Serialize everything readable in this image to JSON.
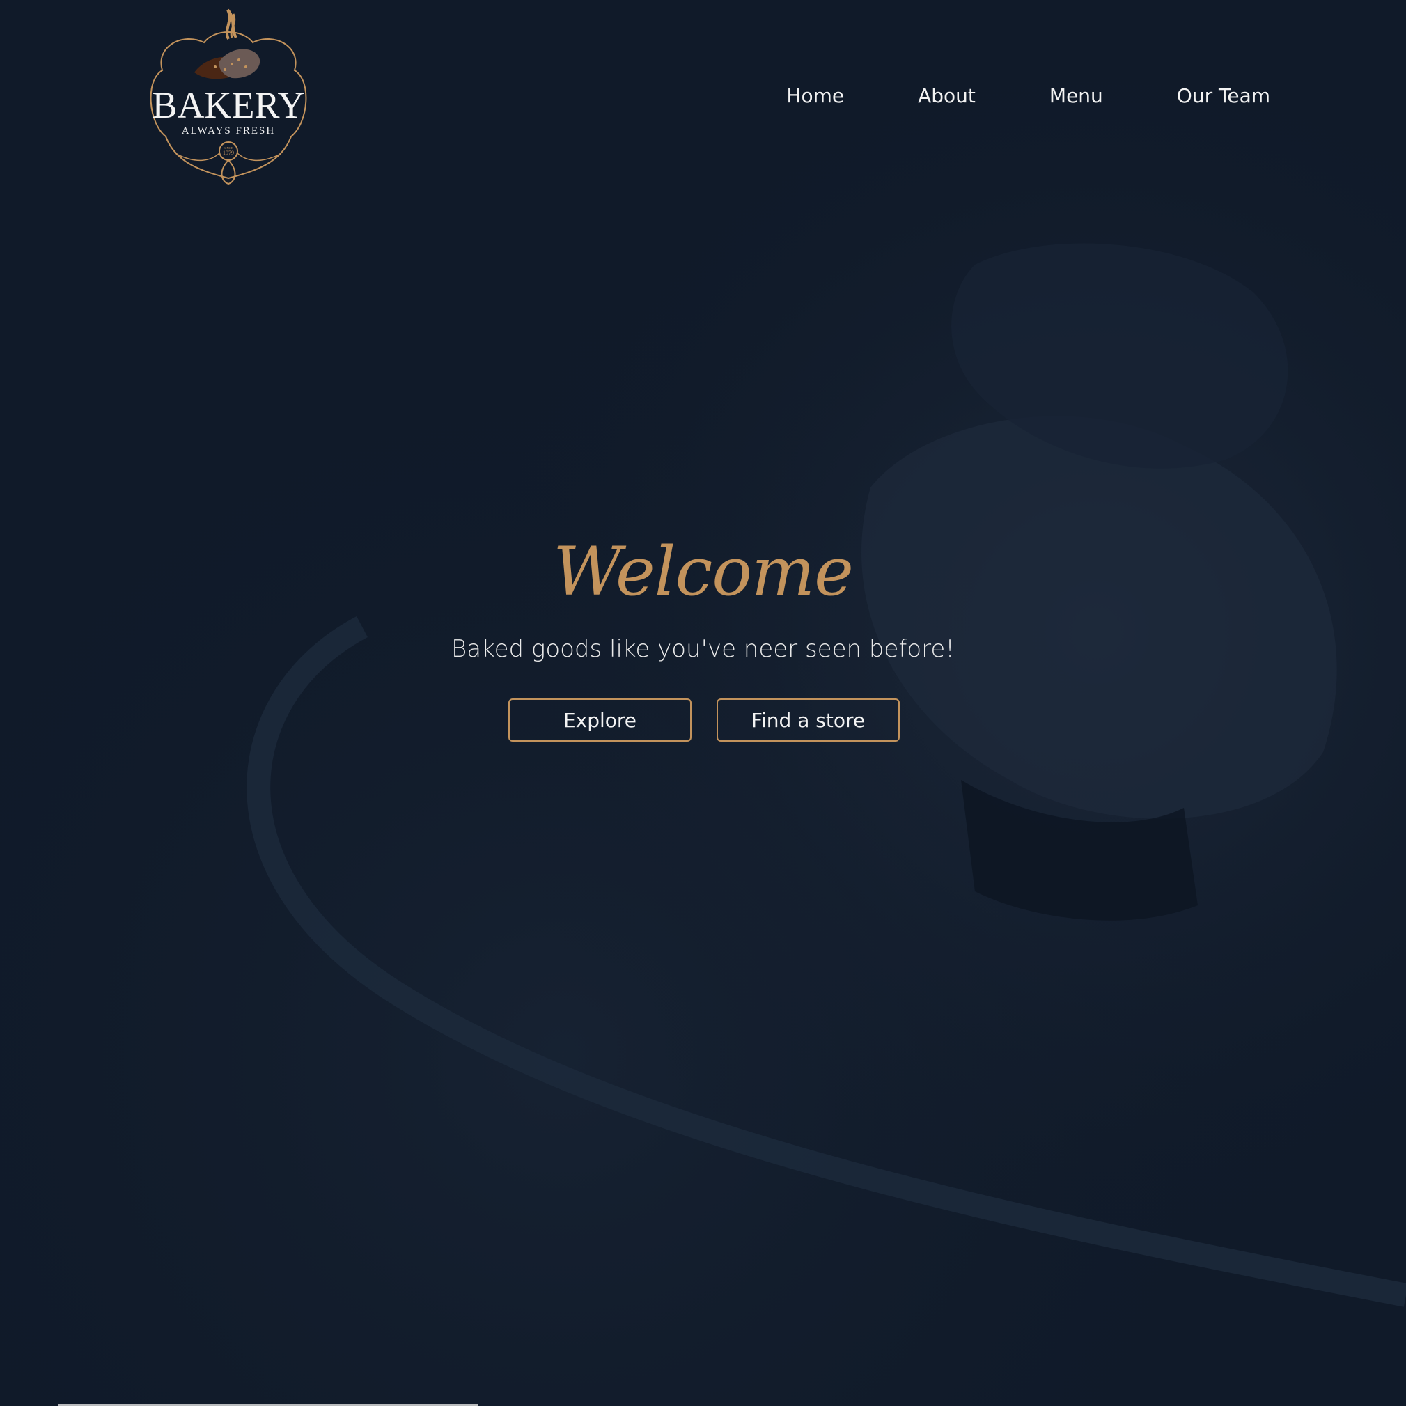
{
  "brand": {
    "name": "BAKERY",
    "tagline": "ALWAYS FRESH",
    "since": "SINCE",
    "year": "1979"
  },
  "nav": {
    "items": [
      {
        "label": "Home"
      },
      {
        "label": "About"
      },
      {
        "label": "Menu"
      },
      {
        "label": "Our Team"
      }
    ]
  },
  "hero": {
    "title": "Welcome",
    "subtitle": "Baked goods like you've neer seen before!",
    "buttons": {
      "explore_label": "Explore",
      "store_label": "Find a store"
    }
  },
  "colors": {
    "background": "#101a29",
    "accent": "#c3935c",
    "text": "#f3f3f3"
  },
  "icons": {
    "logo": "bakery-badge-logo"
  }
}
